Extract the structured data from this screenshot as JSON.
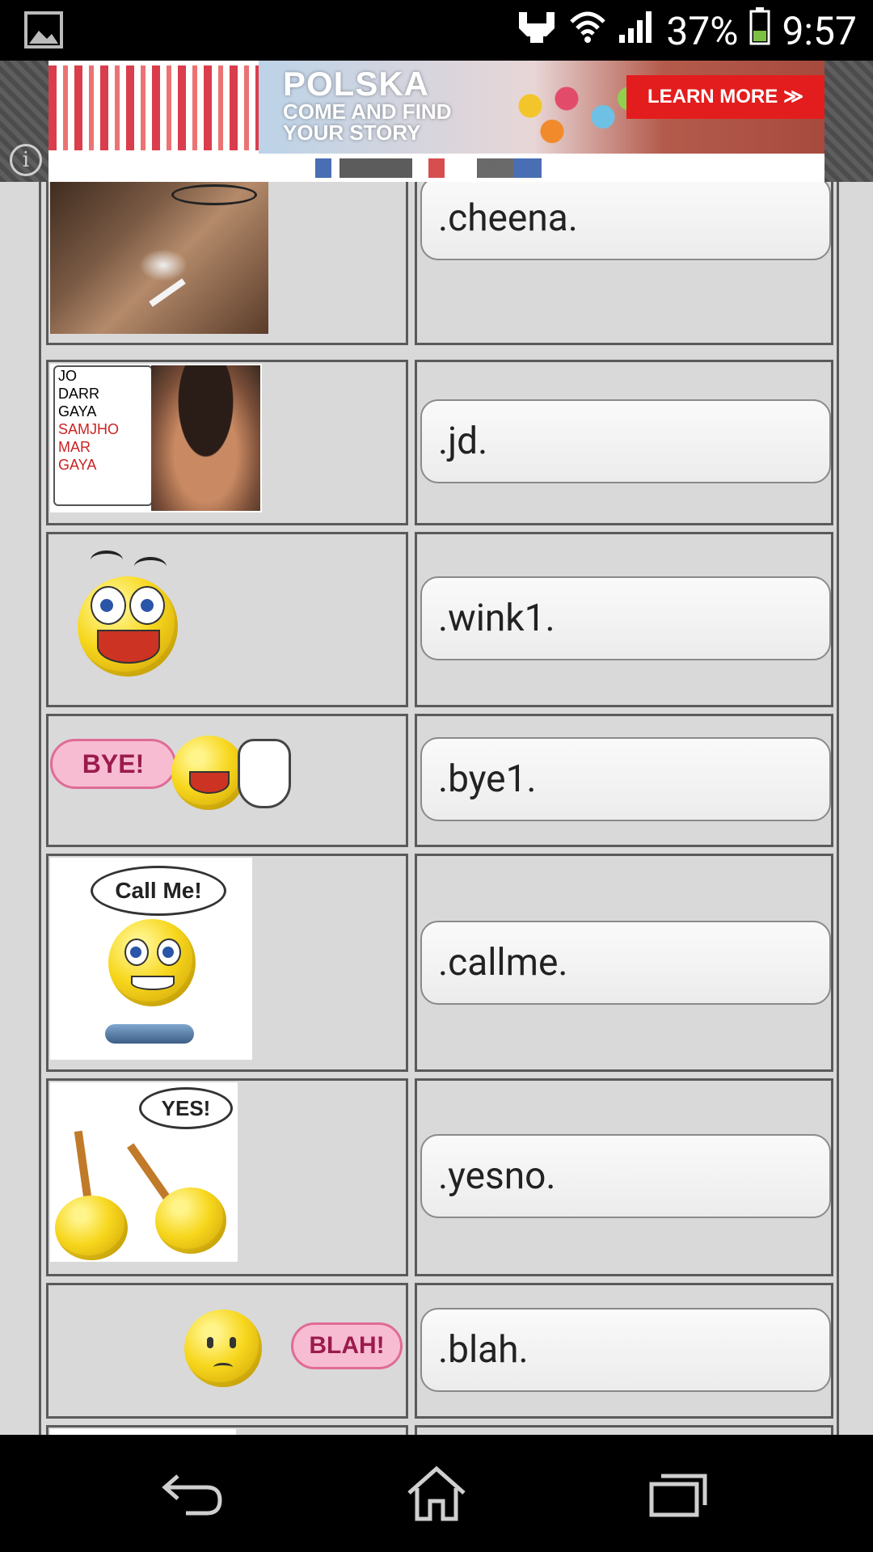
{
  "status_bar": {
    "battery_percent": "37%",
    "time": "9:57",
    "icons": [
      "picture-icon",
      "usb-debug-icon",
      "wifi-icon",
      "signal-icon",
      "battery-icon"
    ]
  },
  "ad": {
    "title_line1": "POLSKA",
    "title_line2": "COME AND FIND",
    "title_line3": "YOUR STORY",
    "cta": "LEARN MORE ≫",
    "info_icon": "info-icon"
  },
  "rows": [
    {
      "code": ".cheena.",
      "image": "smoking-man-photo"
    },
    {
      "code": ".jd.",
      "image": "jo-darr-gaya-meme",
      "meme_text": [
        "JO",
        "DARR",
        "GAYA",
        "SAMJHO",
        "MAR",
        "GAYA"
      ]
    },
    {
      "code": ".wink1.",
      "image": "laughing-smiley"
    },
    {
      "code": ".bye1.",
      "image": "bye-smiley",
      "bubble": "BYE!"
    },
    {
      "code": ".callme.",
      "image": "call-me-smiley",
      "bubble": "Call Me!"
    },
    {
      "code": ".yesno.",
      "image": "yes-no-smileys",
      "bubble": "YES!"
    },
    {
      "code": ".blah.",
      "image": "blah-smiley",
      "bubble": "BLAH!"
    }
  ],
  "nav_bar": {
    "icons": [
      "back-icon",
      "home-icon",
      "recent-apps-icon"
    ]
  }
}
